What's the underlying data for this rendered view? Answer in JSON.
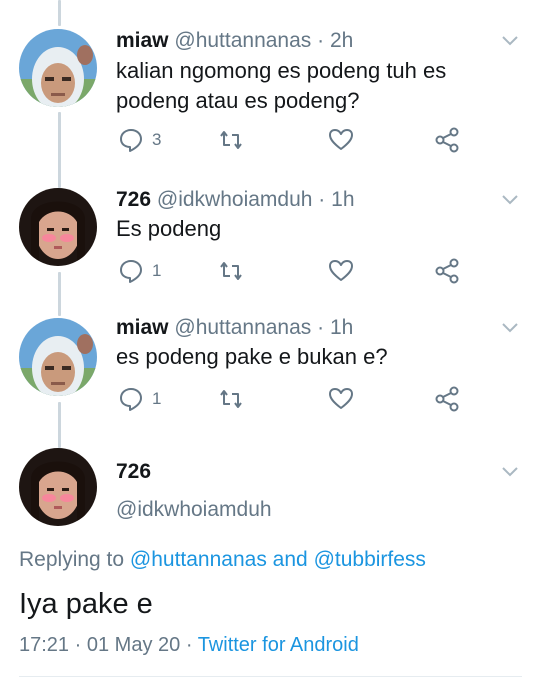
{
  "tweets": [
    {
      "name": "miaw",
      "handle": "@huttannanas",
      "sep": "·",
      "time": "2h",
      "text": "kalian ngomong es podeng tuh es podeng atau es podeng?",
      "reply_count": "3",
      "retweet_count": "",
      "like_count": ""
    },
    {
      "name": "726",
      "handle": "@idkwhoiamduh",
      "sep": "·",
      "time": "1h",
      "text": "Es podeng",
      "reply_count": "1",
      "retweet_count": "",
      "like_count": ""
    },
    {
      "name": "miaw",
      "handle": "@huttannanas",
      "sep": "·",
      "time": "1h",
      "text": "es podeng pake e bukan e?",
      "reply_count": "1",
      "retweet_count": "",
      "like_count": ""
    }
  ],
  "main": {
    "name": "726",
    "handle": "@idkwhoiamduh",
    "replying_prefix": "Replying to",
    "replying_user1": "@huttannanas",
    "replying_and": "and",
    "replying_user2": "@tubbirfess",
    "text": "Iya pake e",
    "time": "17:21",
    "sep": "·",
    "date": "01 May 20",
    "sep2": "·",
    "client": "Twitter for Android"
  },
  "icons": {
    "reply": "reply-icon",
    "retweet": "retweet-icon",
    "like": "heart-icon",
    "share": "share-icon",
    "more": "chevron-down-icon"
  },
  "colors": {
    "text": "#14171a",
    "secondary": "#657786",
    "link": "#1b95e0",
    "thread_line": "#ccd6dd"
  }
}
